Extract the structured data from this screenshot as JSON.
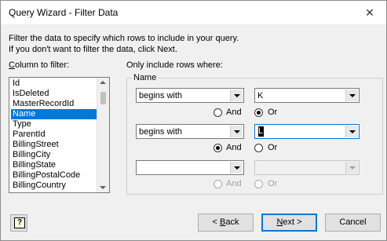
{
  "window": {
    "title": "Query Wizard - Filter Data"
  },
  "intro": {
    "line1": "Filter the data to specify which rows to include in your query.",
    "line2": "If you don't want to filter the data, click Next."
  },
  "column_label_u": "C",
  "column_label_rest": "olumn to filter:",
  "rows_label": "Only include rows where:",
  "group_title": "Name",
  "columns": [
    "Id",
    "IsDeleted",
    "MasterRecordId",
    "Name",
    "Type",
    "ParentId",
    "BillingStreet",
    "BillingCity",
    "BillingState",
    "BillingPostalCode",
    "BillingCountry"
  ],
  "selected_column": "Name",
  "conditions": [
    {
      "operator": "begins with",
      "value": "K"
    },
    {
      "operator": "begins with",
      "value": "L"
    },
    {
      "operator": "",
      "value": ""
    }
  ],
  "radios": {
    "and": "And",
    "or": "Or",
    "row1_selected": "Or",
    "row2_selected": "And"
  },
  "buttons": {
    "help_icon": "help-icon",
    "back_u": "B",
    "back_rest": "ack",
    "back_prefix": "< ",
    "next_u": "N",
    "next_rest": "ext >",
    "cancel": "Cancel"
  }
}
